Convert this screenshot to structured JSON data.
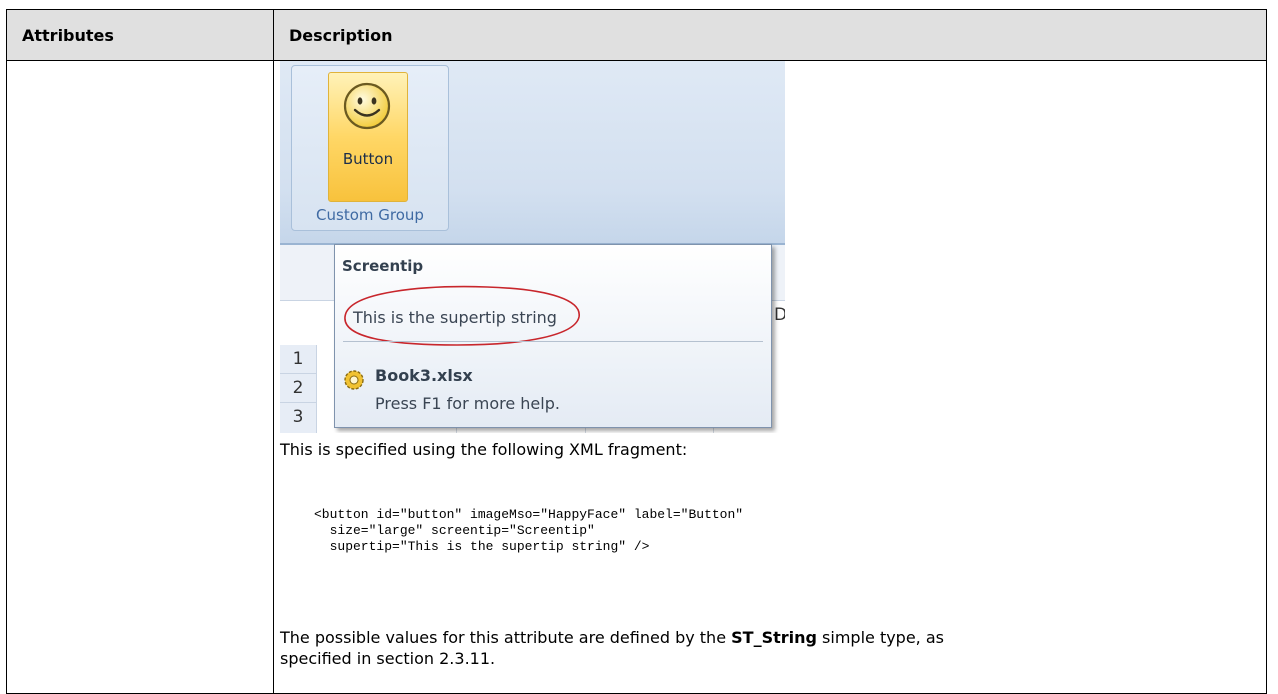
{
  "table": {
    "header_attributes": "Attributes",
    "header_description": "Description"
  },
  "screenshot": {
    "button_label": "Button",
    "group_label": "Custom Group",
    "row_numbers": [
      "1",
      "2",
      "3"
    ],
    "partial_column_letter": "D",
    "screentip": {
      "title": "Screentip",
      "supertip": "This is the supertip string",
      "file_name": "Book3.xlsx",
      "help_text": "Press F1 for more help."
    }
  },
  "description": {
    "intro": "This is specified using the following XML fragment:",
    "xml_code": "<button id=\"button\" imageMso=\"HappyFace\" label=\"Button\"\n  size=\"large\" screentip=\"Screentip\"\n  supertip=\"This is the supertip string\" />",
    "values_prefix": "The possible values for this attribute are defined by the ",
    "values_type": "ST_String",
    "values_suffix": " simple type, as",
    "values_line2": "specified in section 2.3.11."
  }
}
